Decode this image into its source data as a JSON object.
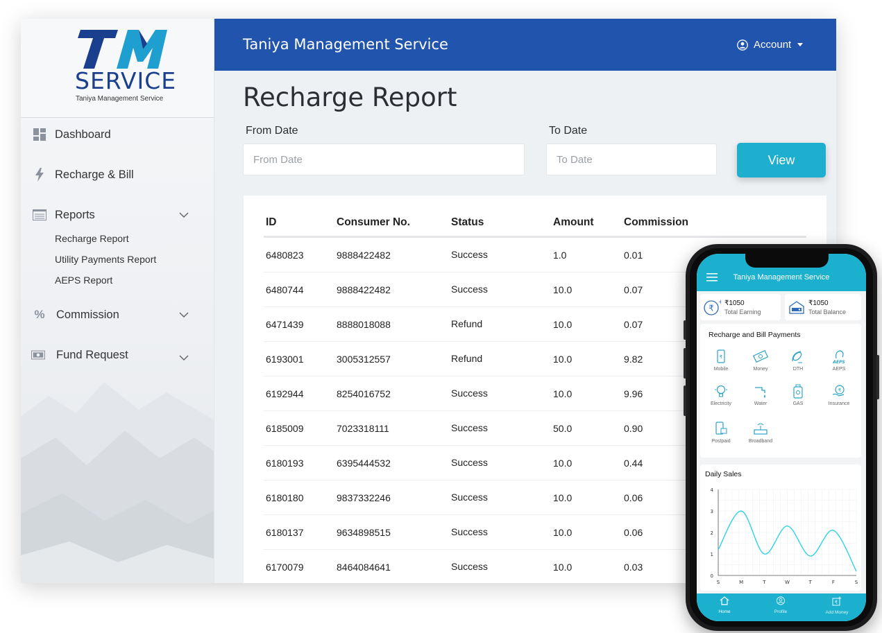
{
  "app": {
    "title": "Taniya Management Service",
    "brand_color": "#2154ac",
    "accent_color": "#1eafcf"
  },
  "logo": {
    "mark": "TM",
    "word": "SERVICE",
    "tagline": "Taniya Management Service"
  },
  "sidebar": {
    "items": [
      {
        "label": "Dashboard",
        "icon": "dashboard-icon"
      },
      {
        "label": "Recharge & Bill",
        "icon": "lightning-icon"
      },
      {
        "label": "Reports",
        "icon": "list-icon",
        "expanded": true
      },
      {
        "label": "Commission",
        "icon": "percent-icon"
      },
      {
        "label": "Fund Request",
        "icon": "money-icon"
      }
    ],
    "report_subitems": [
      "Recharge Report",
      "Utility Payments Report",
      "AEPS Report"
    ]
  },
  "header": {
    "title": "Taniya Management Service",
    "account_label": "Account"
  },
  "main": {
    "page_title": "Recharge Report",
    "from_label": "From Date",
    "from_placeholder": "From Date",
    "to_label": "To Date",
    "to_placeholder": "To Date",
    "view_label": "View"
  },
  "table": {
    "columns": [
      "ID",
      "Consumer No.",
      "Status",
      "Amount",
      "Commission"
    ],
    "rows": [
      [
        "6480823",
        "9888422482",
        "Success",
        "1.0",
        "0.01"
      ],
      [
        "6480744",
        "9888422482",
        "Success",
        "10.0",
        "0.07"
      ],
      [
        "6471439",
        "8888018088",
        "Refund",
        "10.0",
        "0.07"
      ],
      [
        "6193001",
        "3005312557",
        "Refund",
        "10.0",
        "9.82"
      ],
      [
        "6192944",
        "8254016752",
        "Success",
        "10.0",
        "9.96"
      ],
      [
        "6185009",
        "7023318111",
        "Success",
        "50.0",
        "0.90"
      ],
      [
        "6180193",
        "6395444532",
        "Success",
        "10.0",
        "0.44"
      ],
      [
        "6180180",
        "9837332246",
        "Success",
        "10.0",
        "0.06"
      ],
      [
        "6180137",
        "9634898515",
        "Success",
        "10.0",
        "0.06"
      ],
      [
        "6170079",
        "8464084641",
        "Success",
        "10.0",
        "0.03"
      ]
    ]
  },
  "mobile": {
    "title": "Taniya Management Service",
    "earning_amount": "₹1050",
    "earning_label": "Total Earning",
    "balance_amount": "₹1050",
    "balance_label": "Total Balance",
    "services_title": "Recharge and Bill Payments",
    "services": [
      "Mobile",
      "Money",
      "DTH",
      "AEPS",
      "Electricity",
      "Water",
      "GAS",
      "Insurance",
      "Postpaid",
      "Broadband"
    ],
    "tabs": [
      "Home",
      "Profile",
      "Add Money"
    ]
  },
  "chart_data": {
    "type": "line",
    "title": "Daily Sales",
    "x": [
      "S",
      "M",
      "T",
      "W",
      "T",
      "F",
      "S"
    ],
    "series": [
      {
        "values": [
          1.2,
          3.0,
          1.0,
          2.3,
          0.9,
          2.1,
          0.2
        ]
      }
    ],
    "ylim": [
      0,
      4
    ],
    "yticks": [
      0,
      1,
      2,
      3,
      4
    ],
    "line_color": "#2ed3e6",
    "grid": true
  }
}
